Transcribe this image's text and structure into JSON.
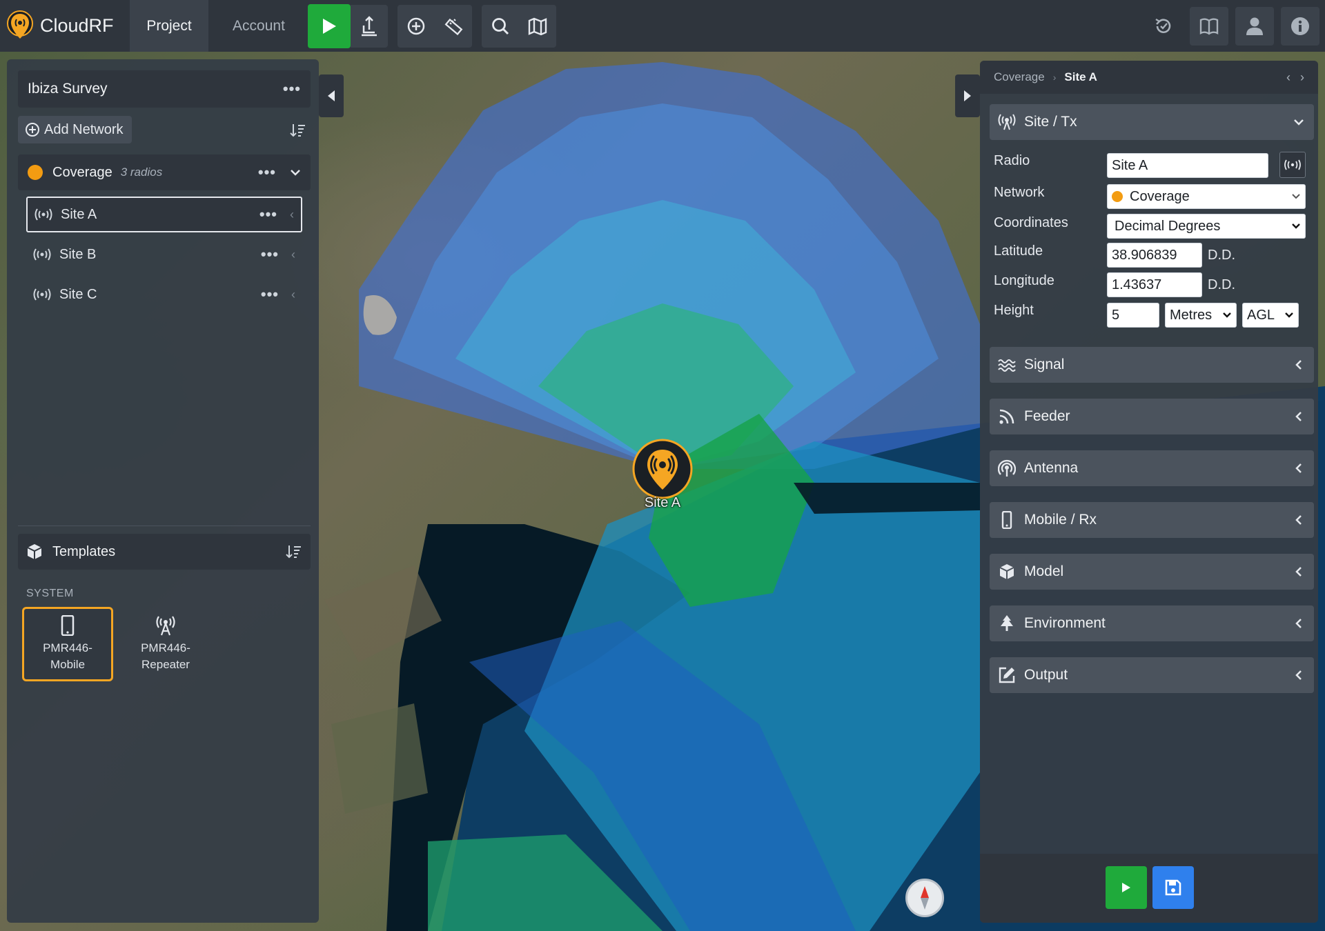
{
  "app": {
    "name": "CloudRF"
  },
  "nav": {
    "tab_project": "Project",
    "tab_account": "Account"
  },
  "toolbar": {
    "icons": [
      "play-icon",
      "upload-tower-icon",
      "plus-circle-icon",
      "ruler-icon",
      "search-icon",
      "map-icon"
    ],
    "right_icons": [
      "history-icon",
      "book-icon",
      "user-icon",
      "info-icon"
    ]
  },
  "left_panel": {
    "project_title": "Ibiza Survey",
    "add_network_label": "Add Network",
    "network": {
      "name": "Coverage",
      "count_label": "3 radios",
      "color": "#f39c12"
    },
    "sites": [
      {
        "name": "Site A",
        "selected": true
      },
      {
        "name": "Site B",
        "selected": false
      },
      {
        "name": "Site C",
        "selected": false
      }
    ],
    "templates_label": "Templates",
    "system_label": "SYSTEM",
    "templates": [
      {
        "line1": "PMR446-",
        "line2": "Mobile",
        "icon": "mobile-phone-icon",
        "selected": true
      },
      {
        "line1": "PMR446-",
        "line2": "Repeater",
        "icon": "antenna-tower-icon",
        "selected": false
      }
    ]
  },
  "right_panel": {
    "breadcrumb": {
      "parent": "Coverage",
      "current": "Site A"
    },
    "sections": {
      "site_tx": "Site / Tx",
      "signal": "Signal",
      "feeder": "Feeder",
      "antenna": "Antenna",
      "mobile_rx": "Mobile / Rx",
      "model": "Model",
      "environment": "Environment",
      "output": "Output"
    },
    "form": {
      "radio_label": "Radio",
      "radio_value": "Site A",
      "network_label": "Network",
      "network_value": "Coverage",
      "coordinates_label": "Coordinates",
      "coordinates_value": "Decimal Degrees",
      "latitude_label": "Latitude",
      "latitude_value": "38.906839",
      "latitude_unit": "D.D.",
      "longitude_label": "Longitude",
      "longitude_value": "1.43637",
      "longitude_unit": "D.D.",
      "height_label": "Height",
      "height_value": "5",
      "height_unit": "Metres",
      "height_ref": "AGL"
    },
    "footer": {
      "run_color": "#1faa3b",
      "save_color": "#2f80ed"
    }
  },
  "map": {
    "marker_label": "Site A"
  },
  "colors": {
    "accent_orange": "#f39c12",
    "run_green": "#1faa3b",
    "save_blue": "#2f80ed"
  }
}
